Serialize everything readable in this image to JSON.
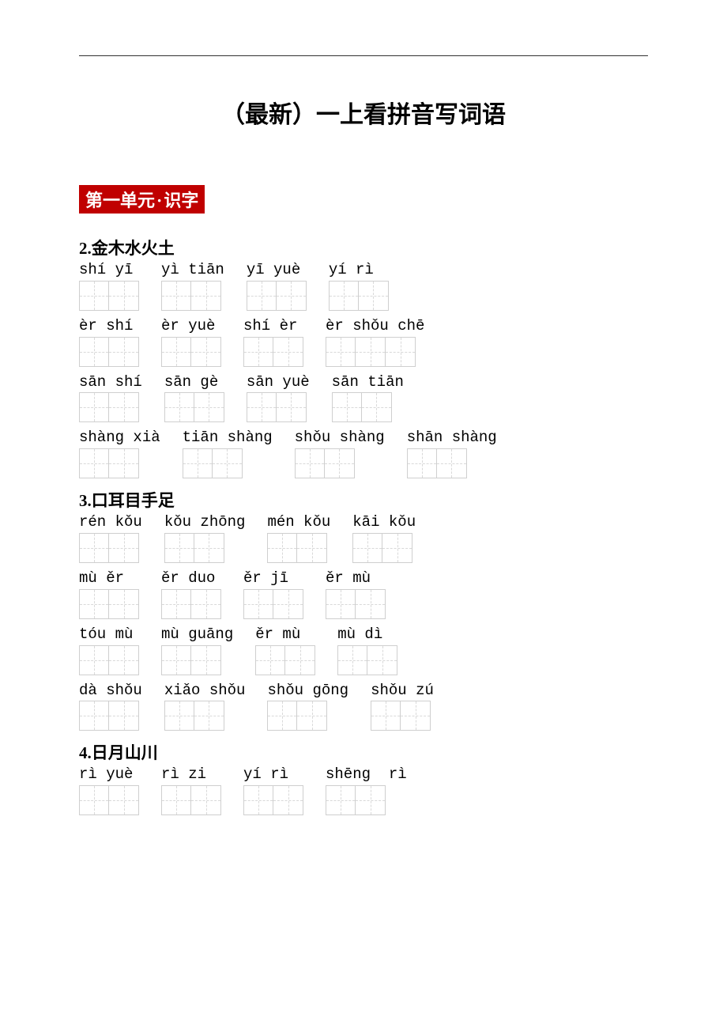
{
  "title": "（最新）一上看拼音写词语",
  "unit_badge": {
    "left": "第一单元",
    "dot": "·",
    "right": "识字"
  },
  "lessons": [
    {
      "title": "2.金木水火土",
      "rows": [
        [
          {
            "pinyin": "shí yī",
            "cells": 2
          },
          {
            "pinyin": "yì tiān",
            "cells": 2
          },
          {
            "pinyin": "yī yuè",
            "cells": 2
          },
          {
            "pinyin": "yí rì",
            "cells": 2
          }
        ],
        [
          {
            "pinyin": "èr shí",
            "cells": 2
          },
          {
            "pinyin": "èr yuè",
            "cells": 2
          },
          {
            "pinyin": "shí èr",
            "cells": 2
          },
          {
            "pinyin": "èr shǒu chē",
            "cells": 3
          }
        ],
        [
          {
            "pinyin": "sān shí",
            "cells": 2
          },
          {
            "pinyin": "sān gè",
            "cells": 2
          },
          {
            "pinyin": "sān yuè",
            "cells": 2
          },
          {
            "pinyin": "sān tiān",
            "cells": 2
          }
        ],
        [
          {
            "pinyin": "shàng xià",
            "cells": 2
          },
          {
            "pinyin": "tiān shàng",
            "cells": 2
          },
          {
            "pinyin": "shǒu shàng",
            "cells": 2
          },
          {
            "pinyin": "shān shàng",
            "cells": 2
          }
        ]
      ]
    },
    {
      "title": "3.口耳目手足",
      "rows": [
        [
          {
            "pinyin": "rén kǒu",
            "cells": 2
          },
          {
            "pinyin": "kǒu zhōng",
            "cells": 2
          },
          {
            "pinyin": "mén kǒu",
            "cells": 2
          },
          {
            "pinyin": "kāi kǒu",
            "cells": 2
          }
        ],
        [
          {
            "pinyin": "mù ěr",
            "cells": 2
          },
          {
            "pinyin": "ěr duo",
            "cells": 2
          },
          {
            "pinyin": "ěr jī",
            "cells": 2
          },
          {
            "pinyin": "ěr mù",
            "cells": 2
          }
        ],
        [
          {
            "pinyin": "tóu mù",
            "cells": 2
          },
          {
            "pinyin": "mù guāng",
            "cells": 2
          },
          {
            "pinyin": "ěr mù",
            "cells": 2
          },
          {
            "pinyin": "mù dì",
            "cells": 2
          }
        ],
        [
          {
            "pinyin": "dà shǒu",
            "cells": 2
          },
          {
            "pinyin": "xiǎo shǒu",
            "cells": 2
          },
          {
            "pinyin": "shǒu gōng",
            "cells": 2
          },
          {
            "pinyin": "shǒu zú",
            "cells": 2
          }
        ]
      ]
    },
    {
      "title": "4.日月山川",
      "rows": [
        [
          {
            "pinyin": "rì yuè",
            "cells": 2
          },
          {
            "pinyin": "rì zi",
            "cells": 2
          },
          {
            "pinyin": "yí rì",
            "cells": 2
          },
          {
            "pinyin": "shēng  rì",
            "cells": 2
          }
        ]
      ]
    }
  ]
}
